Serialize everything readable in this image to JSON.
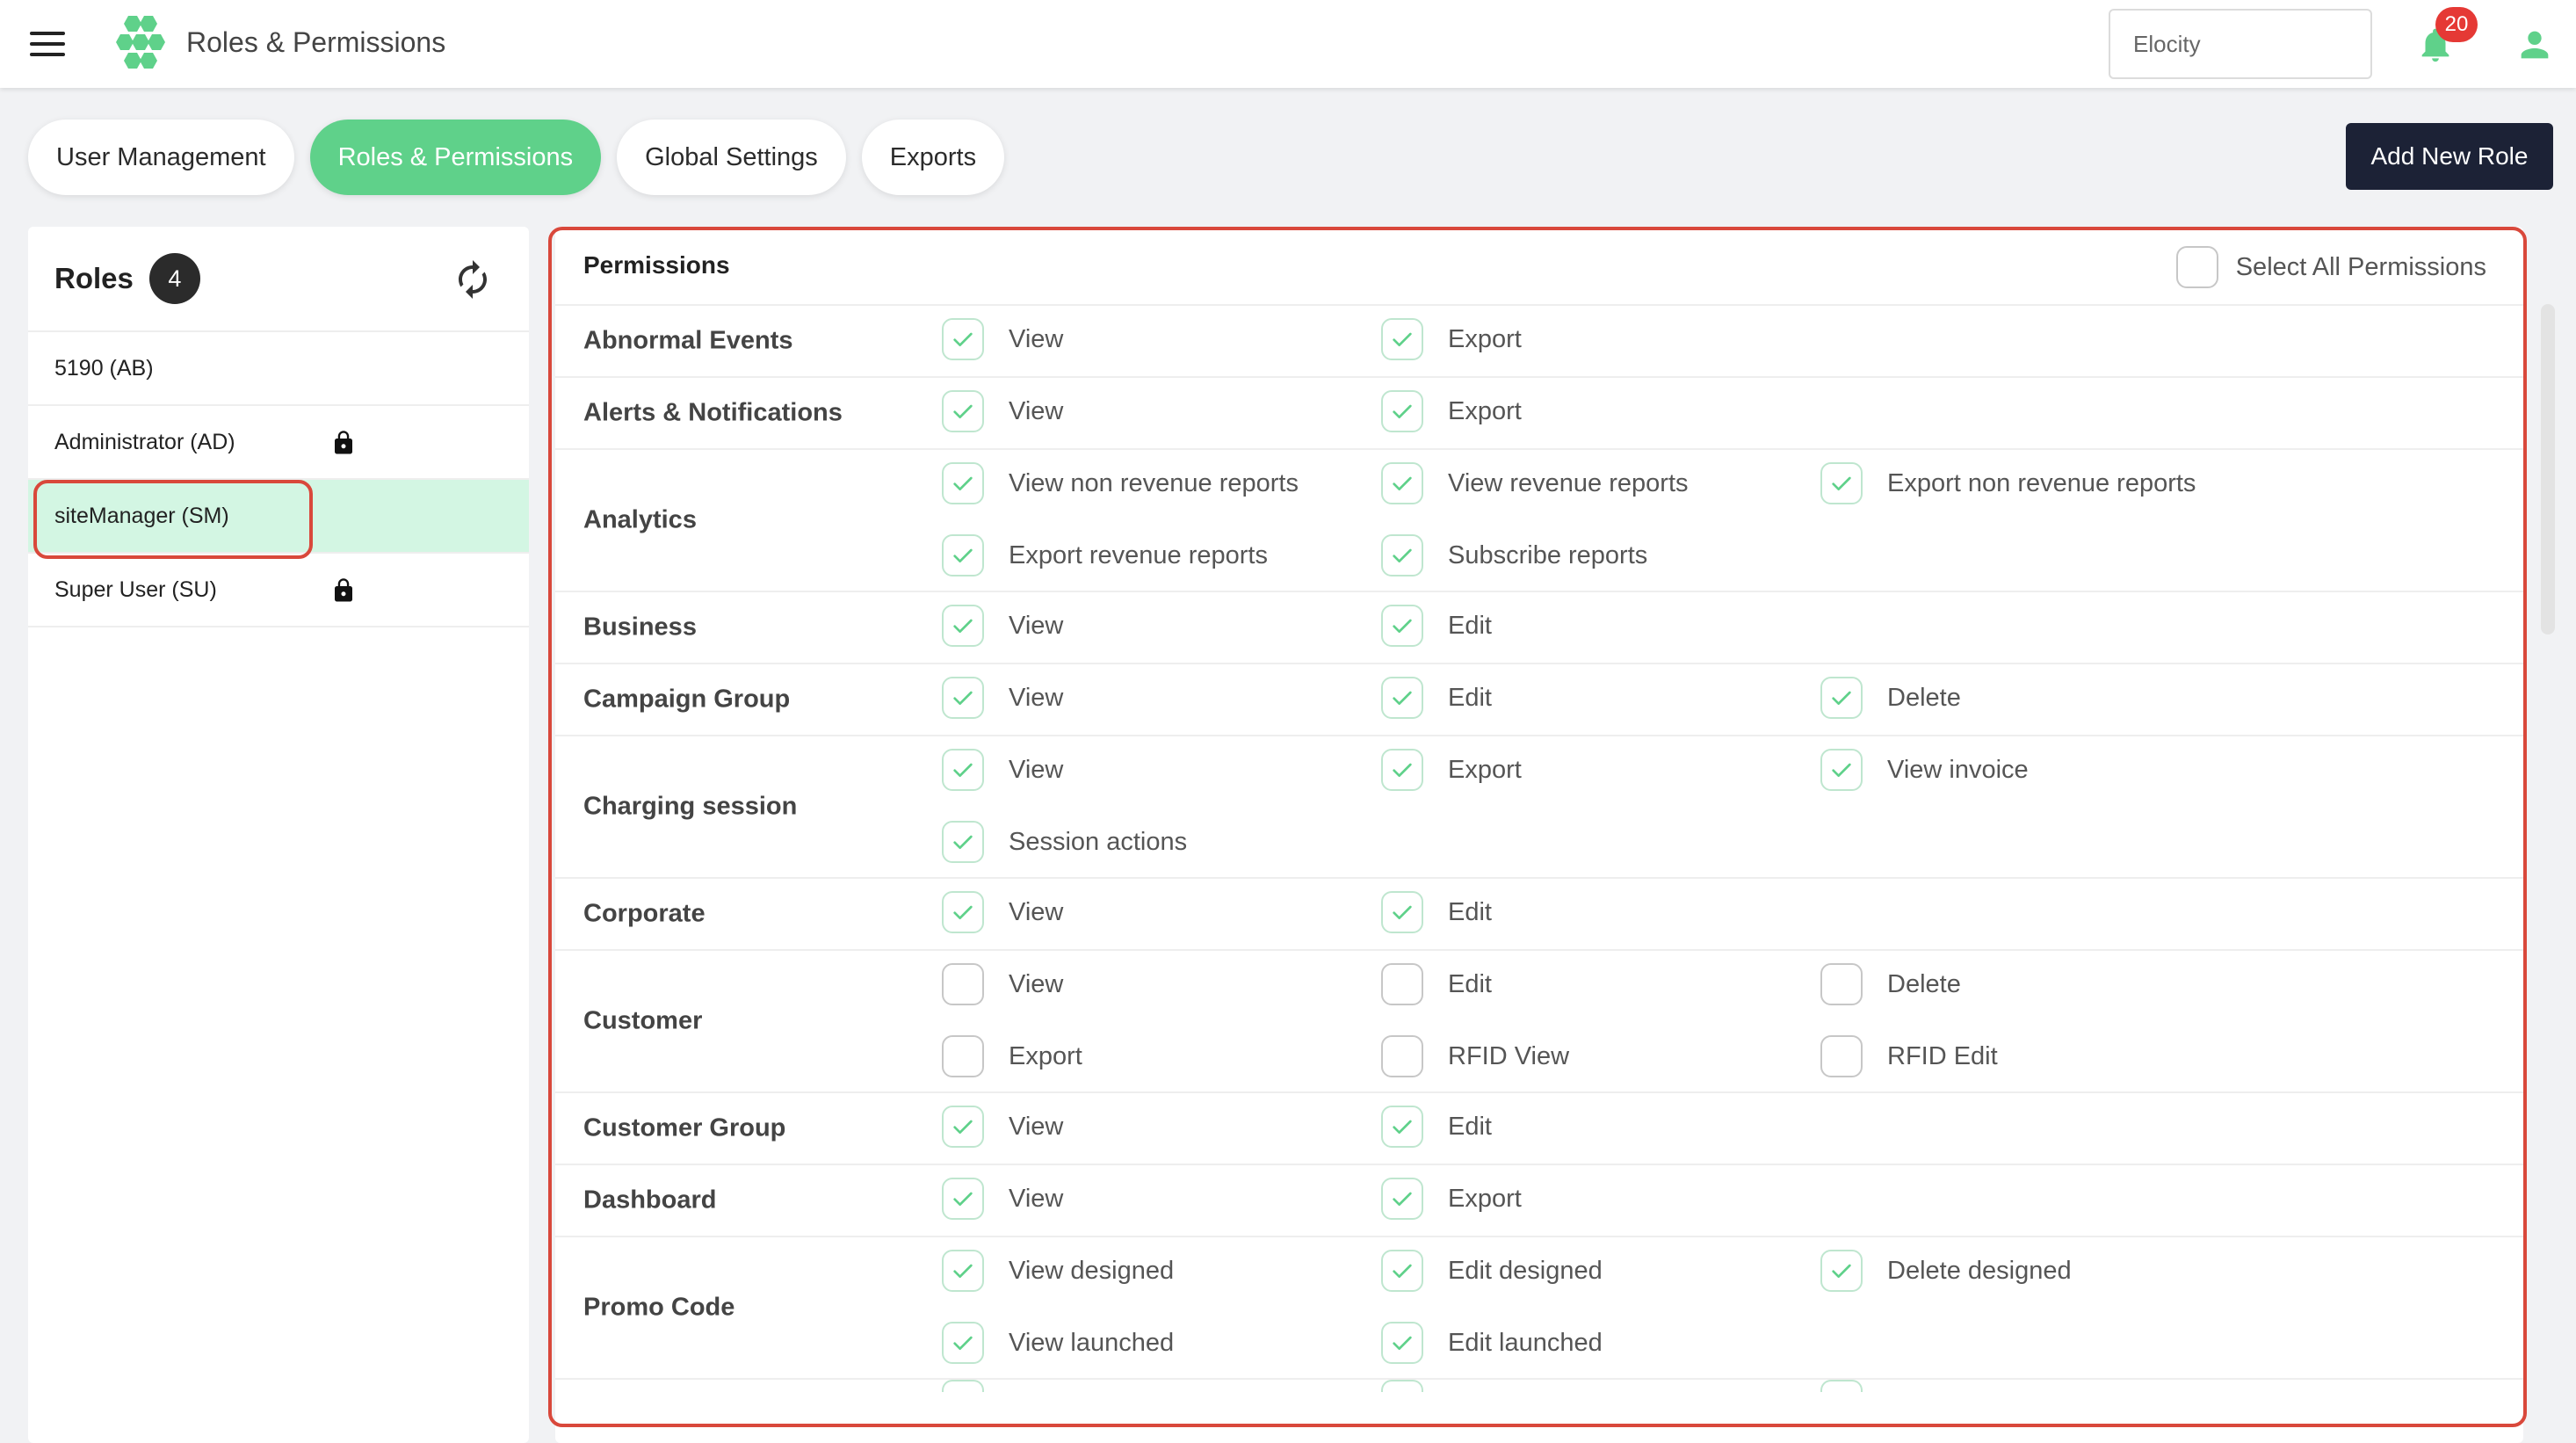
{
  "app": {
    "title": "Roles & Permissions",
    "search_value": "Elocity",
    "notifications_count": "20",
    "colors": {
      "accent": "#5fd18a",
      "primary_dark": "#1c2236",
      "badge": "#e53935",
      "highlight": "#d9483b"
    }
  },
  "tabs": [
    {
      "label": "User Management",
      "active": false
    },
    {
      "label": "Roles & Permissions",
      "active": true
    },
    {
      "label": "Global Settings",
      "active": false
    },
    {
      "label": "Exports",
      "active": false
    }
  ],
  "add_role_label": "Add New Role",
  "roles": {
    "title": "Roles",
    "count": "4",
    "items": [
      {
        "name": "5190 (AB)",
        "locked": false,
        "selected": false
      },
      {
        "name": "Administrator (AD)",
        "locked": true,
        "selected": false
      },
      {
        "name": "siteManager (SM)",
        "locked": false,
        "selected": true
      },
      {
        "name": "Super User (SU)",
        "locked": true,
        "selected": false
      }
    ]
  },
  "permissions": {
    "title": "Permissions",
    "select_all_label": "Select All Permissions",
    "select_all_checked": false,
    "groups": [
      {
        "name": "Abnormal Events",
        "options": [
          {
            "label": "View",
            "checked": true
          },
          {
            "label": "Export",
            "checked": true
          }
        ]
      },
      {
        "name": "Alerts & Notifications",
        "options": [
          {
            "label": "View",
            "checked": true
          },
          {
            "label": "Export",
            "checked": true
          }
        ]
      },
      {
        "name": "Analytics",
        "options": [
          {
            "label": "View non revenue reports",
            "checked": true
          },
          {
            "label": "View revenue reports",
            "checked": true
          },
          {
            "label": "Export non revenue reports",
            "checked": true
          },
          {
            "label": "Export revenue reports",
            "checked": true
          },
          {
            "label": "Subscribe reports",
            "checked": true
          }
        ]
      },
      {
        "name": "Business",
        "options": [
          {
            "label": "View",
            "checked": true
          },
          {
            "label": "Edit",
            "checked": true
          }
        ]
      },
      {
        "name": "Campaign Group",
        "options": [
          {
            "label": "View",
            "checked": true
          },
          {
            "label": "Edit",
            "checked": true
          },
          {
            "label": "Delete",
            "checked": true
          }
        ]
      },
      {
        "name": "Charging session",
        "options": [
          {
            "label": "View",
            "checked": true
          },
          {
            "label": "Export",
            "checked": true
          },
          {
            "label": "View invoice",
            "checked": true
          },
          {
            "label": "Session actions",
            "checked": true
          }
        ]
      },
      {
        "name": "Corporate",
        "options": [
          {
            "label": "View",
            "checked": true
          },
          {
            "label": "Edit",
            "checked": true
          }
        ]
      },
      {
        "name": "Customer",
        "options": [
          {
            "label": "View",
            "checked": false
          },
          {
            "label": "Edit",
            "checked": false
          },
          {
            "label": "Delete",
            "checked": false
          },
          {
            "label": "Export",
            "checked": false
          },
          {
            "label": "RFID View",
            "checked": false
          },
          {
            "label": "RFID Edit",
            "checked": false
          }
        ]
      },
      {
        "name": "Customer Group",
        "options": [
          {
            "label": "View",
            "checked": true
          },
          {
            "label": "Edit",
            "checked": true
          }
        ]
      },
      {
        "name": "Dashboard",
        "options": [
          {
            "label": "View",
            "checked": true
          },
          {
            "label": "Export",
            "checked": true
          }
        ]
      },
      {
        "name": "Promo Code",
        "options": [
          {
            "label": "View designed",
            "checked": true
          },
          {
            "label": "Edit designed",
            "checked": true
          },
          {
            "label": "Delete designed",
            "checked": true
          },
          {
            "label": "View launched",
            "checked": true
          },
          {
            "label": "Edit launched",
            "checked": true
          }
        ]
      }
    ]
  }
}
